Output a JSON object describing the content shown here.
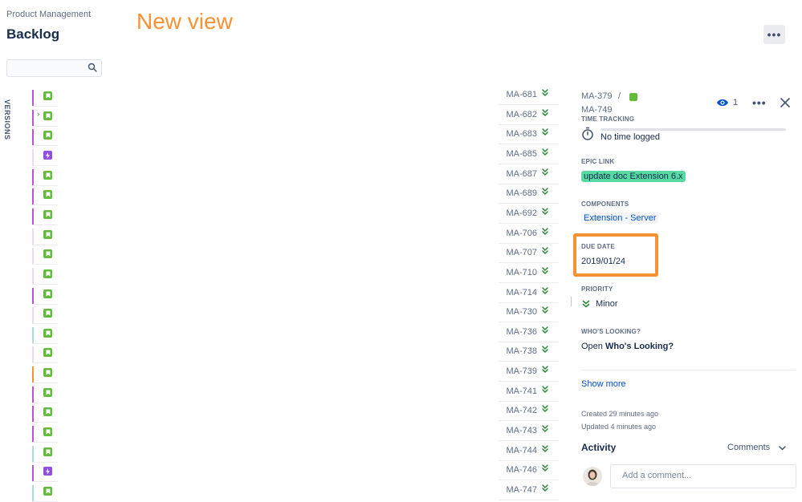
{
  "header": {
    "project_name": "Product Management",
    "page_title": "Backlog",
    "annotation": "New view",
    "more_label": "•••"
  },
  "search": {
    "placeholder": ""
  },
  "sidebar": {
    "versions_label": "VERSIONS"
  },
  "issues": [
    {
      "key": "MA-681",
      "type": "story",
      "epic_color": "#c152d4",
      "expand": false
    },
    {
      "key": "MA-682",
      "type": "story",
      "epic_color": "#c152d4",
      "expand": true
    },
    {
      "key": "MA-683",
      "type": "story",
      "epic_color": "#c152d4",
      "expand": false
    },
    {
      "key": "MA-685",
      "type": "epic",
      "epic_color": "#f1d8f5",
      "expand": false
    },
    {
      "key": "MA-687",
      "type": "story",
      "epic_color": "#c152d4",
      "expand": false
    },
    {
      "key": "MA-689",
      "type": "story",
      "epic_color": "#c152d4",
      "expand": false
    },
    {
      "key": "MA-692",
      "type": "story",
      "epic_color": "#c152d4",
      "expand": false
    },
    {
      "key": "MA-706",
      "type": "story",
      "epic_color": "#f1d8f5",
      "expand": false
    },
    {
      "key": "MA-707",
      "type": "story",
      "epic_color": "#f1d8f5",
      "expand": false
    },
    {
      "key": "MA-710",
      "type": "story",
      "epic_color": "#f1d8f5",
      "expand": false
    },
    {
      "key": "MA-714",
      "type": "story",
      "epic_color": "#c152d4",
      "expand": false
    },
    {
      "key": "MA-730",
      "type": "story",
      "epic_color": "#f1d8f5",
      "expand": false
    },
    {
      "key": "MA-736",
      "type": "story",
      "epic_color": "#abe2cb",
      "expand": false
    },
    {
      "key": "MA-738",
      "type": "story",
      "epic_color": "#f1d8f5",
      "expand": false
    },
    {
      "key": "MA-739",
      "type": "story",
      "epic_color": "#f79232",
      "expand": false
    },
    {
      "key": "MA-741",
      "type": "story",
      "epic_color": "#c152d4",
      "expand": false
    },
    {
      "key": "MA-742",
      "type": "story",
      "epic_color": "#c152d4",
      "expand": false
    },
    {
      "key": "MA-743",
      "type": "story",
      "epic_color": "#c152d4",
      "expand": false
    },
    {
      "key": "MA-744",
      "type": "story",
      "epic_color": "#abe2cb",
      "expand": false
    },
    {
      "key": "MA-746",
      "type": "epic",
      "epic_color": "#c152d4",
      "expand": false
    },
    {
      "key": "MA-747",
      "type": "story",
      "epic_color": "#abe2cb",
      "expand": false
    }
  ],
  "detail": {
    "breadcrumb_parent": "MA-379",
    "breadcrumb_sep": "/",
    "breadcrumb_key": "MA-749",
    "watch_count": "1",
    "more_label": "•••",
    "time_tracking": {
      "label": "TIME TRACKING",
      "value": "No time logged"
    },
    "epic_link": {
      "label": "EPIC LINK",
      "value": "update doc Extension 6.x"
    },
    "components": {
      "label": "COMPONENTS",
      "value": "Extension - Server"
    },
    "due_date": {
      "label": "DUE DATE",
      "value": "2019/01/24"
    },
    "priority": {
      "label": "PRIORITY",
      "value": "Minor"
    },
    "whos_looking": {
      "label": "WHO'S LOOKING?",
      "prefix": "Open",
      "link": "Who's Looking?"
    },
    "show_more": "Show more",
    "created": "Created 29 minutes ago",
    "updated": "Updated 4 minutes ago",
    "activity_title": "Activity",
    "comments_filter": "Comments",
    "comment_placeholder": "Add a comment..."
  },
  "colors": {
    "accent_orange": "#f79232",
    "story_green": "#63ba3c",
    "epic_purple": "#904ee2",
    "link_blue": "#0052cc",
    "epic_lozenge": "#57d9a3",
    "priority_green": "#2a8735"
  },
  "icons": {
    "search": "search-icon",
    "story": "story-icon",
    "epic": "epic-icon",
    "priority_minor": "chevron-double-down-icon",
    "watch": "eye-icon",
    "close": "close-icon",
    "stopwatch": "stopwatch-icon"
  }
}
